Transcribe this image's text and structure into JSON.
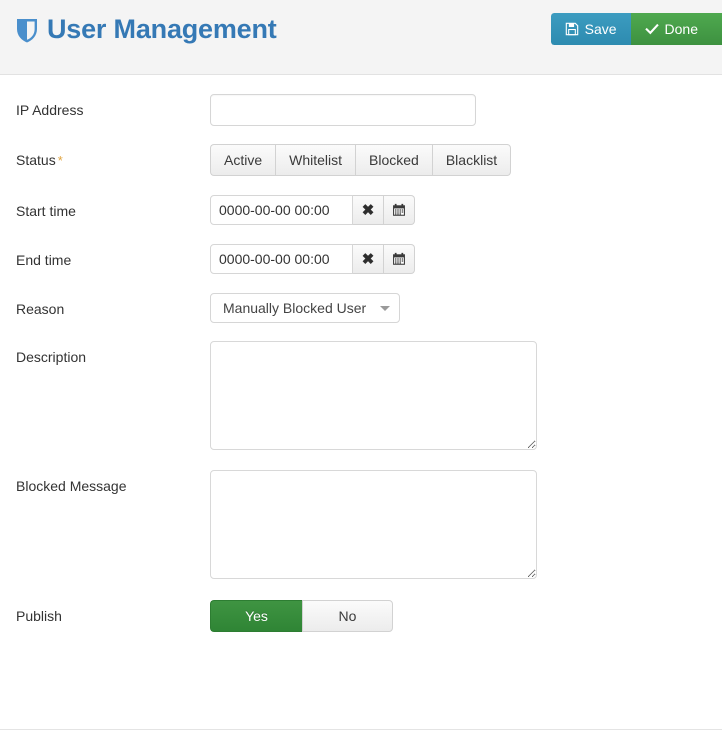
{
  "header": {
    "title": "User Management",
    "shield_icon": "shield-icon",
    "actions": [
      {
        "label": "Save",
        "icon": "floppy-disk-icon",
        "color": "#2d8bb0",
        "style": "save"
      },
      {
        "label": "Done",
        "icon": "check-icon",
        "color": "#3d9140",
        "style": "done"
      }
    ]
  },
  "form": {
    "ip_address": {
      "label": "IP Address",
      "value": "",
      "placeholder": ""
    },
    "status": {
      "label": "Status",
      "required": true,
      "required_marker": "*",
      "options": [
        "Active",
        "Whitelist",
        "Blocked",
        "Blacklist"
      ],
      "selected": null
    },
    "start_time": {
      "label": "Start time",
      "value": "0000-00-00 00:00",
      "clear_label": "✖",
      "calendar_icon": "calendar-icon"
    },
    "end_time": {
      "label": "End time",
      "value": "0000-00-00 00:00",
      "clear_label": "✖",
      "calendar_icon": "calendar-icon"
    },
    "reason": {
      "label": "Reason",
      "selected": "Manually Blocked User",
      "options": [
        "Manually Blocked User"
      ]
    },
    "description": {
      "label": "Description",
      "value": "",
      "placeholder": ""
    },
    "blocked_message": {
      "label": "Blocked Message",
      "value": "",
      "placeholder": ""
    },
    "publish": {
      "label": "Publish",
      "options": [
        "Yes",
        "No"
      ],
      "selected": "Yes"
    }
  }
}
